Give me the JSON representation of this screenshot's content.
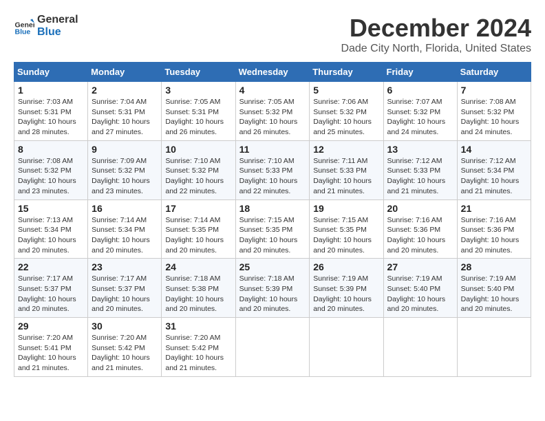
{
  "logo": {
    "general": "General",
    "blue": "Blue"
  },
  "header": {
    "month": "December 2024",
    "location": "Dade City North, Florida, United States"
  },
  "days_of_week": [
    "Sunday",
    "Monday",
    "Tuesday",
    "Wednesday",
    "Thursday",
    "Friday",
    "Saturday"
  ],
  "weeks": [
    [
      {
        "day": "1",
        "sunrise": "7:03 AM",
        "sunset": "5:31 PM",
        "daylight": "10 hours and 28 minutes."
      },
      {
        "day": "2",
        "sunrise": "7:04 AM",
        "sunset": "5:31 PM",
        "daylight": "10 hours and 27 minutes."
      },
      {
        "day": "3",
        "sunrise": "7:05 AM",
        "sunset": "5:31 PM",
        "daylight": "10 hours and 26 minutes."
      },
      {
        "day": "4",
        "sunrise": "7:05 AM",
        "sunset": "5:32 PM",
        "daylight": "10 hours and 26 minutes."
      },
      {
        "day": "5",
        "sunrise": "7:06 AM",
        "sunset": "5:32 PM",
        "daylight": "10 hours and 25 minutes."
      },
      {
        "day": "6",
        "sunrise": "7:07 AM",
        "sunset": "5:32 PM",
        "daylight": "10 hours and 24 minutes."
      },
      {
        "day": "7",
        "sunrise": "7:08 AM",
        "sunset": "5:32 PM",
        "daylight": "10 hours and 24 minutes."
      }
    ],
    [
      {
        "day": "8",
        "sunrise": "7:08 AM",
        "sunset": "5:32 PM",
        "daylight": "10 hours and 23 minutes."
      },
      {
        "day": "9",
        "sunrise": "7:09 AM",
        "sunset": "5:32 PM",
        "daylight": "10 hours and 23 minutes."
      },
      {
        "day": "10",
        "sunrise": "7:10 AM",
        "sunset": "5:32 PM",
        "daylight": "10 hours and 22 minutes."
      },
      {
        "day": "11",
        "sunrise": "7:10 AM",
        "sunset": "5:33 PM",
        "daylight": "10 hours and 22 minutes."
      },
      {
        "day": "12",
        "sunrise": "7:11 AM",
        "sunset": "5:33 PM",
        "daylight": "10 hours and 21 minutes."
      },
      {
        "day": "13",
        "sunrise": "7:12 AM",
        "sunset": "5:33 PM",
        "daylight": "10 hours and 21 minutes."
      },
      {
        "day": "14",
        "sunrise": "7:12 AM",
        "sunset": "5:34 PM",
        "daylight": "10 hours and 21 minutes."
      }
    ],
    [
      {
        "day": "15",
        "sunrise": "7:13 AM",
        "sunset": "5:34 PM",
        "daylight": "10 hours and 20 minutes."
      },
      {
        "day": "16",
        "sunrise": "7:14 AM",
        "sunset": "5:34 PM",
        "daylight": "10 hours and 20 minutes."
      },
      {
        "day": "17",
        "sunrise": "7:14 AM",
        "sunset": "5:35 PM",
        "daylight": "10 hours and 20 minutes."
      },
      {
        "day": "18",
        "sunrise": "7:15 AM",
        "sunset": "5:35 PM",
        "daylight": "10 hours and 20 minutes."
      },
      {
        "day": "19",
        "sunrise": "7:15 AM",
        "sunset": "5:35 PM",
        "daylight": "10 hours and 20 minutes."
      },
      {
        "day": "20",
        "sunrise": "7:16 AM",
        "sunset": "5:36 PM",
        "daylight": "10 hours and 20 minutes."
      },
      {
        "day": "21",
        "sunrise": "7:16 AM",
        "sunset": "5:36 PM",
        "daylight": "10 hours and 20 minutes."
      }
    ],
    [
      {
        "day": "22",
        "sunrise": "7:17 AM",
        "sunset": "5:37 PM",
        "daylight": "10 hours and 20 minutes."
      },
      {
        "day": "23",
        "sunrise": "7:17 AM",
        "sunset": "5:37 PM",
        "daylight": "10 hours and 20 minutes."
      },
      {
        "day": "24",
        "sunrise": "7:18 AM",
        "sunset": "5:38 PM",
        "daylight": "10 hours and 20 minutes."
      },
      {
        "day": "25",
        "sunrise": "7:18 AM",
        "sunset": "5:39 PM",
        "daylight": "10 hours and 20 minutes."
      },
      {
        "day": "26",
        "sunrise": "7:19 AM",
        "sunset": "5:39 PM",
        "daylight": "10 hours and 20 minutes."
      },
      {
        "day": "27",
        "sunrise": "7:19 AM",
        "sunset": "5:40 PM",
        "daylight": "10 hours and 20 minutes."
      },
      {
        "day": "28",
        "sunrise": "7:19 AM",
        "sunset": "5:40 PM",
        "daylight": "10 hours and 20 minutes."
      }
    ],
    [
      {
        "day": "29",
        "sunrise": "7:20 AM",
        "sunset": "5:41 PM",
        "daylight": "10 hours and 21 minutes."
      },
      {
        "day": "30",
        "sunrise": "7:20 AM",
        "sunset": "5:42 PM",
        "daylight": "10 hours and 21 minutes."
      },
      {
        "day": "31",
        "sunrise": "7:20 AM",
        "sunset": "5:42 PM",
        "daylight": "10 hours and 21 minutes."
      },
      null,
      null,
      null,
      null
    ]
  ],
  "labels": {
    "sunrise": "Sunrise:",
    "sunset": "Sunset:",
    "daylight": "Daylight:"
  }
}
